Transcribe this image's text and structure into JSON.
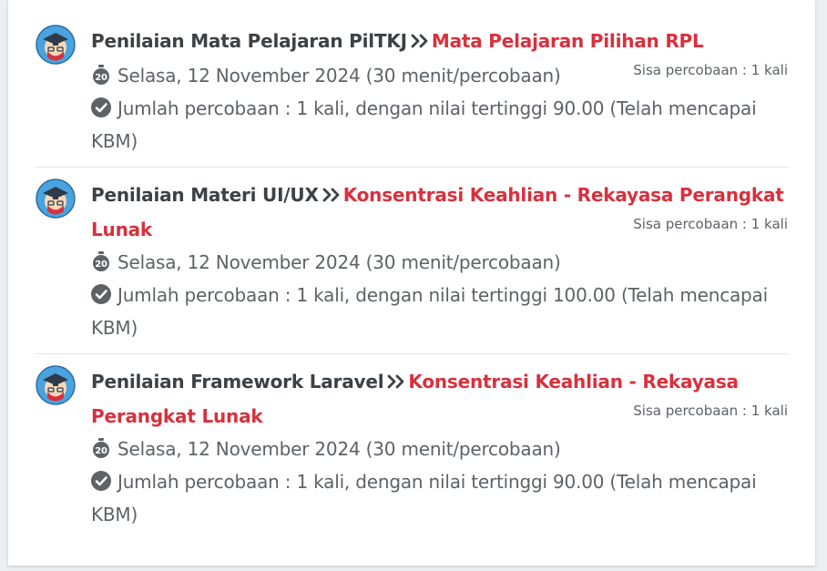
{
  "items": [
    {
      "name": "Penilaian Mata Pelajaran PilTKJ",
      "course": "Mata Pelajaran Pilihan RPL",
      "remaining": "Sisa percobaan : 1 kali",
      "schedule": "Selasa, 12 November 2024 (30 menit/percobaan)",
      "result": "Jumlah percobaan : 1 kali, dengan nilai tertinggi 90.00 (Telah mencapai KBM)"
    },
    {
      "name": "Penilaian Materi UI/UX",
      "course": "Konsentrasi Keahlian - Rekayasa Perangkat Lunak",
      "remaining": "Sisa percobaan : 1 kali",
      "schedule": "Selasa, 12 November 2024 (30 menit/percobaan)",
      "result": "Jumlah percobaan : 1 kali, dengan nilai tertinggi 100.00 (Telah mencapai KBM)"
    },
    {
      "name": "Penilaian Framework Laravel",
      "course": "Konsentrasi Keahlian - Rekayasa Perangkat Lunak",
      "remaining": "Sisa percobaan : 1 kali",
      "schedule": "Selasa, 12 November 2024 (30 menit/percobaan)",
      "result": "Jumlah percobaan : 1 kali, dengan nilai tertinggi 90.00 (Telah mencapai KBM)"
    }
  ],
  "icons": {
    "avatar": "student-graduate-avatar-icon",
    "separator": "double-chevron-right-icon",
    "timer": "stopwatch-20-icon",
    "done": "check-circle-icon"
  },
  "colors": {
    "title": "#3d4146",
    "course_link": "#d9303d",
    "body_text": "#5e6267",
    "avatar_bg": "#4aa3df"
  }
}
